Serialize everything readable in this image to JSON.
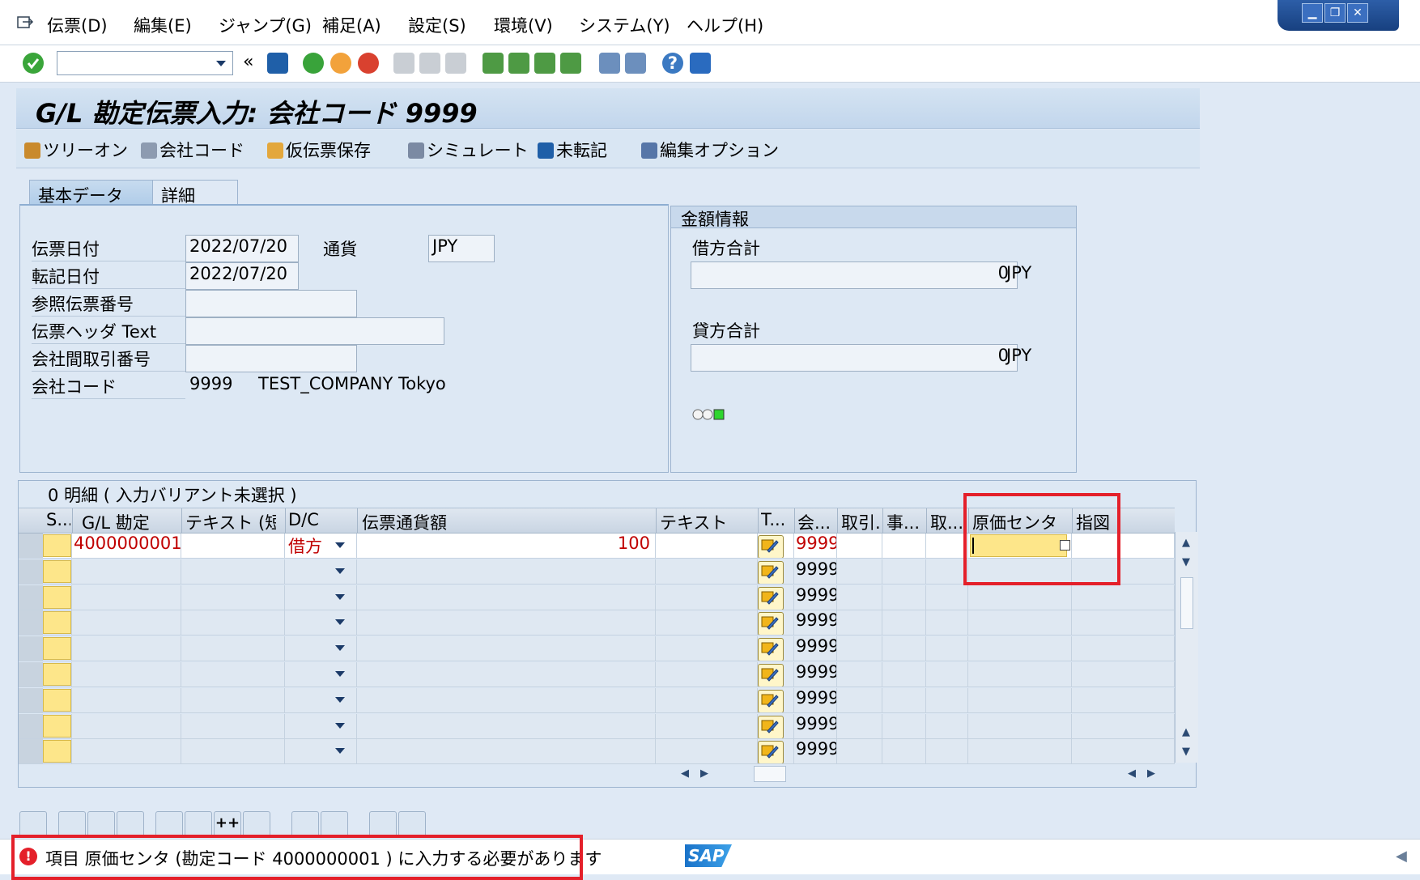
{
  "menu": {
    "items": [
      "伝票(D)",
      "編集(E)",
      "ジャンプ(G)",
      "補足(A)",
      "設定(S)",
      "環境(V)",
      "システム(Y)",
      "ヘルプ(H)"
    ]
  },
  "toolbar": {
    "command_field": "",
    "collapse": "«",
    "icons": [
      "enter-icon",
      "save-icon",
      "back-icon",
      "exit-icon",
      "cancel-icon",
      "print-icon",
      "find-icon",
      "find-next-icon",
      "first-page-icon",
      "prev-page-icon",
      "next-page-icon",
      "last-page-icon",
      "new-session-icon",
      "shortcut-icon",
      "help-icon",
      "customize-layout-icon"
    ]
  },
  "title": "G/L 勘定伝票入力: 会社コード 9999",
  "app_toolbar": {
    "tree_on": "ツリーオン",
    "company_code": "会社コード",
    "park": "仮伝票保存",
    "simulate": "シミュレート",
    "unposted": "未転記",
    "edit_options": "編集オプション"
  },
  "tabs": {
    "basic": "基本データ",
    "detail": "詳細"
  },
  "basic_data": {
    "doc_date_label": "伝票日付",
    "doc_date": "2022/07/20",
    "currency_label": "通貨",
    "currency": "JPY",
    "posting_date_label": "転記日付",
    "posting_date": "2022/07/20",
    "reference_label": "参照伝票番号",
    "reference": "",
    "header_text_label": "伝票ヘッダ Text",
    "header_text": "",
    "intercompany_label": "会社間取引番号",
    "intercompany": "",
    "company_code_label": "会社コード",
    "company_code": "9999",
    "company_name": "TEST_COMPANY Tokyo"
  },
  "amount_info": {
    "title": "金額情報",
    "debit_label": "借方合計",
    "debit_value": "0",
    "debit_currency": "JPY",
    "credit_label": "貸方合計",
    "credit_value": "0",
    "credit_currency": "JPY",
    "status_lights": "balance-status-icon"
  },
  "grid": {
    "title": "0 明細 ( 入力バリアント未選択 )",
    "columns": [
      "S...",
      "G/L 勘定",
      "テキスト (短)",
      "D/C",
      "伝票通貨額",
      "テキスト",
      "T...",
      "会...",
      "取引...",
      "事...",
      "取...",
      "原価センタ",
      "指図"
    ],
    "rows": [
      {
        "gl_account": "4000000001",
        "dc": "借方",
        "amount": "100",
        "company": "9999"
      },
      {
        "gl_account": "",
        "dc": "",
        "amount": "",
        "company": "9999"
      },
      {
        "gl_account": "",
        "dc": "",
        "amount": "",
        "company": "9999"
      },
      {
        "gl_account": "",
        "dc": "",
        "amount": "",
        "company": "9999"
      },
      {
        "gl_account": "",
        "dc": "",
        "amount": "",
        "company": "9999"
      },
      {
        "gl_account": "",
        "dc": "",
        "amount": "",
        "company": "9999"
      },
      {
        "gl_account": "",
        "dc": "",
        "amount": "",
        "company": "9999"
      },
      {
        "gl_account": "",
        "dc": "",
        "amount": "",
        "company": "9999"
      },
      {
        "gl_account": "",
        "dc": "",
        "amount": "",
        "company": "9999"
      }
    ]
  },
  "bottom_toolbar": {
    "plus_plus": "++"
  },
  "status": {
    "message": "項目 原価センタ (勘定コード 4000000001 ) に入力する必要があります",
    "logo": "SAP"
  },
  "colors": {
    "error_red": "#e4202a",
    "required_yellow": "#fde68a",
    "panel_blue": "#dde8f4",
    "title_blue": "#c2d6ec"
  }
}
